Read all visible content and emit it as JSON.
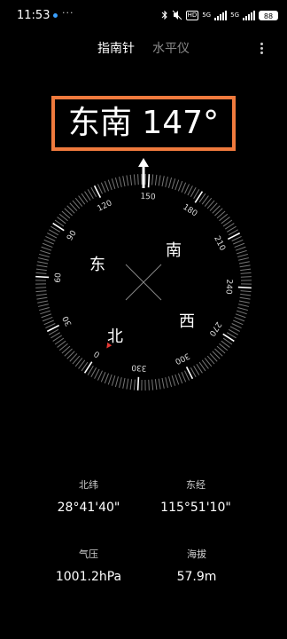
{
  "status_bar": {
    "time": "11:53",
    "more": "···",
    "hd": "HD",
    "net1": "5G",
    "net2": "5G",
    "battery": "88"
  },
  "tabs": {
    "compass": "指南针",
    "level": "水平仪"
  },
  "heading": {
    "text": "东南 147°",
    "degrees": 147
  },
  "dial": {
    "cardinals": {
      "east": "东",
      "south": "南",
      "west": "西",
      "north": "北"
    },
    "tick_labels": [
      "0",
      "30",
      "60",
      "90",
      "120",
      "150",
      "180",
      "210",
      "240",
      "270",
      "300",
      "330"
    ]
  },
  "info": {
    "latitude_label": "北纬",
    "latitude_value": "28°41'40\"",
    "longitude_label": "东经",
    "longitude_value": "115°51'10\"",
    "pressure_label": "气压",
    "pressure_value": "1001.2hPa",
    "altitude_label": "海拔",
    "altitude_value": "57.9m"
  },
  "colors": {
    "accent": "#f07a3d",
    "north_marker": "#e53935"
  }
}
